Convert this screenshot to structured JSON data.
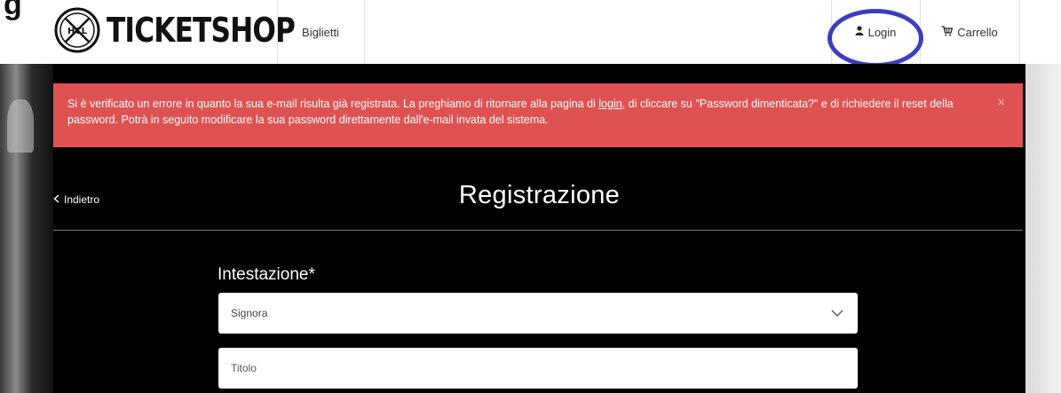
{
  "top_cut_text": "g",
  "header": {
    "brand": "TICKETSHOP",
    "logo_badge_text": "HCL",
    "nav_tickets": "Biglietti",
    "login_label": "Login",
    "cart_label": "Carrello",
    "icons": {
      "login": "user-icon",
      "cart": "cart-icon"
    },
    "annotation_color": "#3a3fbf"
  },
  "alert": {
    "text_before_link": "Si è verificato un errore in quanto la sua e-mail risulta già registrata. La preghiamo di ritornare alla pagina di ",
    "link": "login",
    "text_after_link": ", di cliccare su \"Password dimenticata?\" e di richiedere il reset della password. Potrà in seguito modificare la sua password direttamente dall'e-mail invata del sistema.",
    "close_symbol": "×",
    "background_color": "#e05252"
  },
  "back_label": "Indietro",
  "page_title": "Registrazione",
  "form": {
    "intestazione_label": "Intestazione*",
    "intestazione_value": "Signora",
    "titolo_placeholder": "Titolo"
  }
}
